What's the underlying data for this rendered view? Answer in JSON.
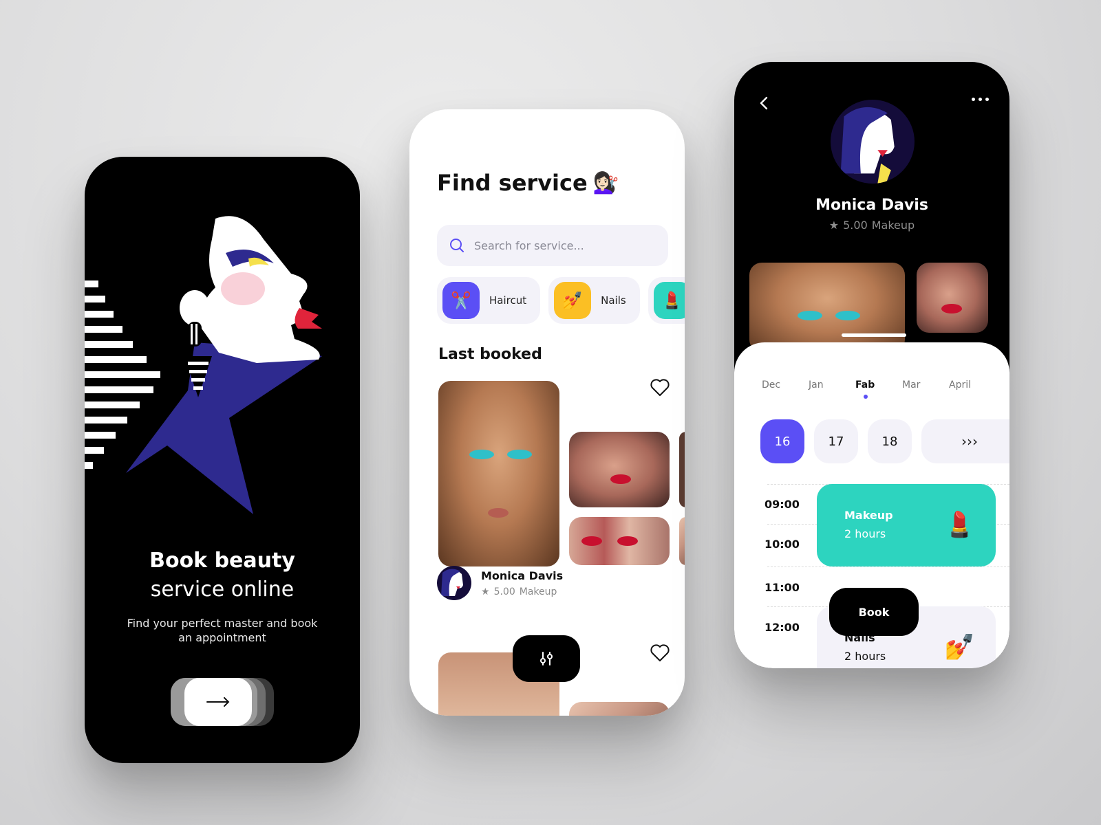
{
  "onboarding": {
    "title": "Book beauty",
    "subtitle": "service online",
    "description": "Find your perfect master and book an appointment",
    "next_icon": "arrow-right-icon"
  },
  "find_service": {
    "title": "Find service",
    "title_emoji": "💇🏻‍♀️",
    "search": {
      "placeholder": "Search for service...",
      "value": "",
      "icon": "search-icon"
    },
    "categories": [
      {
        "label": "Haircut",
        "emoji": "✂️",
        "color": "#5b4ff5"
      },
      {
        "label": "Nails",
        "emoji": "💅",
        "color": "#fbbf24"
      },
      {
        "label": "",
        "emoji": "💄",
        "color": "#2dd4bf"
      }
    ],
    "section_title": "Last booked",
    "last_booked": {
      "name": "Monica Davis",
      "rating": "5.00",
      "category": "Makeup"
    },
    "filter_icon": "sliders-icon"
  },
  "profile": {
    "name": "Monica Davis",
    "rating": "5.00",
    "category": "Makeup",
    "months": [
      {
        "label": "Dec",
        "active": false
      },
      {
        "label": "Jan",
        "active": false
      },
      {
        "label": "Fab",
        "active": true
      },
      {
        "label": "Mar",
        "active": false
      },
      {
        "label": "April",
        "active": false
      }
    ],
    "days": [
      {
        "label": "16",
        "active": true
      },
      {
        "label": "17",
        "active": false
      },
      {
        "label": "18",
        "active": false
      }
    ],
    "more_days": "›››",
    "times": [
      "09:00",
      "10:00",
      "11:00",
      "12:00"
    ],
    "appointments": [
      {
        "title": "Makeup",
        "duration": "2 hours",
        "emoji": "💄"
      },
      {
        "title": "Nails",
        "duration": "2 hours",
        "emoji": "💅"
      }
    ],
    "book_label": "Book",
    "accent": "#5b4ff5",
    "teal": "#2dd4bf"
  }
}
